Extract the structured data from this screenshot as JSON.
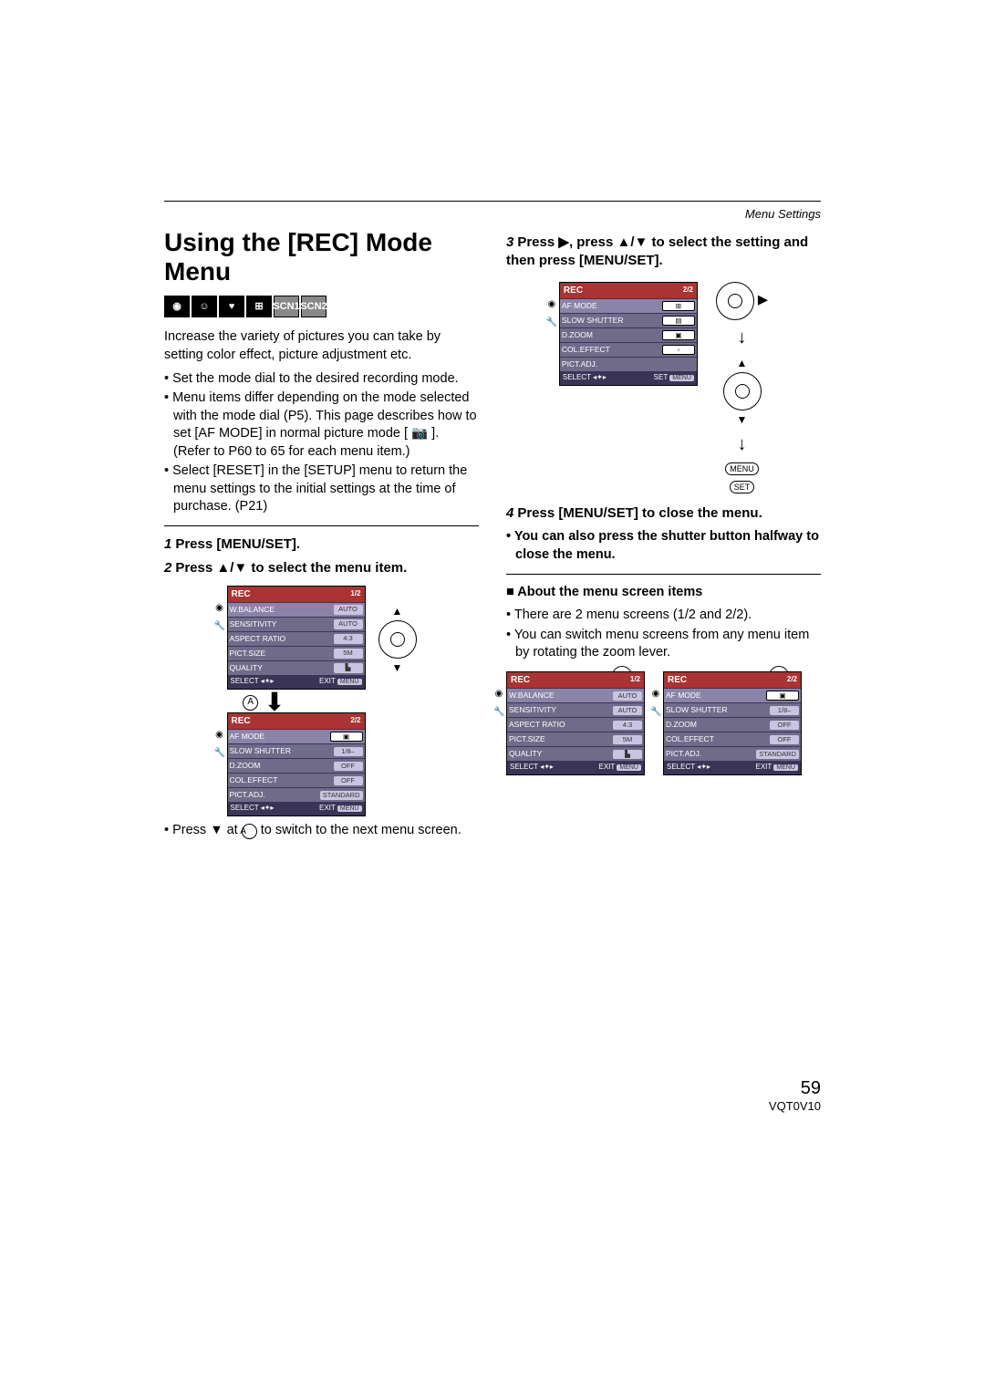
{
  "header": {
    "section": "Menu Settings"
  },
  "title": "Using the [REC] Mode Menu",
  "intro": "Increase the variety of pictures you can take by setting color effect, picture adjustment etc.",
  "intro_bullets": [
    "Set the mode dial to the desired recording mode.",
    "Menu items differ depending on the mode selected with the mode dial (P5). This page describes how to set [AF MODE] in normal picture mode [ 📷 ]. (Refer to P60 to 65 for each menu item.)",
    "Select [RESET] in the [SETUP] menu to return the menu settings to the initial settings at the time of purchase. (P21)"
  ],
  "steps": {
    "s1": {
      "num": "1",
      "text": "Press [MENU/SET]."
    },
    "s2": {
      "num": "2",
      "text_a": "Press ",
      "text_b": " to select the menu item."
    },
    "s2_note_a": "Press ",
    "s2_note_b": " at ",
    "s2_note_c": " to switch to the next menu screen.",
    "s3": {
      "num": "3",
      "text_a": "Press ",
      "text_b": ", press ",
      "text_c": " to select the setting and then press [MENU/SET]."
    },
    "s4": {
      "num": "4",
      "text": "Press [MENU/SET] to close the menu."
    },
    "s4_sub": "You can also press the shutter button halfway to close the menu."
  },
  "about": {
    "heading": "About the menu screen items",
    "b1": "There are 2 menu screens (1/2 and 2/2).",
    "b2": "You can switch menu screens from any menu item by rotating the zoom lever."
  },
  "menu1": {
    "title": "REC",
    "page": "1/2",
    "rows": [
      {
        "label": "W.BALANCE",
        "val": "AUTO"
      },
      {
        "label": "SENSITIVITY",
        "val": "AUTO"
      },
      {
        "label": "ASPECT RATIO",
        "val": "4:3"
      },
      {
        "label": "PICT.SIZE",
        "val": "5M"
      },
      {
        "label": "QUALITY",
        "val": "▙"
      }
    ],
    "footer_l": "SELECT",
    "footer_r": "EXIT"
  },
  "menu2": {
    "title": "REC",
    "page": "2/2",
    "rows": [
      {
        "label": "AF MODE",
        "val": "▣"
      },
      {
        "label": "SLOW SHUTTER",
        "val": "1/8–"
      },
      {
        "label": "D.ZOOM",
        "val": "OFF"
      },
      {
        "label": "COL.EFFECT",
        "val": "OFF"
      },
      {
        "label": "PICT.ADJ.",
        "val": "STANDARD"
      }
    ],
    "footer_l": "SELECT",
    "footer_r": "EXIT"
  },
  "menu3": {
    "title": "REC",
    "page": "2/2",
    "rows": [
      {
        "label": "AF MODE",
        "val": "⊞"
      },
      {
        "label": "SLOW SHUTTER",
        "val": "▤"
      },
      {
        "label": "D.ZOOM",
        "val": "▣"
      },
      {
        "label": "COL.EFFECT",
        "val": "▫"
      },
      {
        "label": "PICT.ADJ.",
        "val": ""
      }
    ],
    "footer_l": "SELECT",
    "footer_r": "SET"
  },
  "ctrl_labels": {
    "menu": "MENU",
    "set": "SET"
  },
  "circ_a": "A",
  "footer": {
    "page": "59",
    "code": "VQT0V10"
  }
}
